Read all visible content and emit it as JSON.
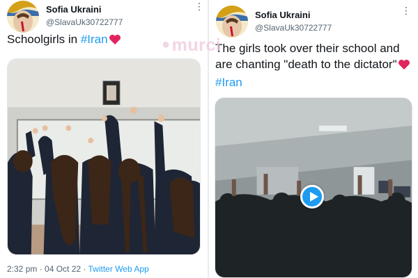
{
  "tweets": [
    {
      "author": {
        "name": "Sofia Ukraini",
        "handle": "@SlavaUk30722777"
      },
      "text": "Schoolgirls in ",
      "hashtag": "#Iran",
      "icons": {
        "menu": "more-vertical-icon",
        "emoji": "red-heart-icon"
      },
      "meta": {
        "time": "2:32 pm",
        "date": "04 Oct 22",
        "sep": " · ",
        "source": "Twitter Web App"
      }
    },
    {
      "author": {
        "name": "Sofia Ukraini",
        "handle": "@SlavaUk30722777"
      },
      "text": "The girls took over their school and are chanting \"death to the dictator\"",
      "hashtag": "#Iran",
      "icons": {
        "menu": "more-vertical-icon",
        "emoji": "red-heart-icon",
        "play": "play-icon"
      }
    }
  ],
  "watermark": "murci",
  "colors": {
    "link": "#1d9bf0",
    "heart": "#e0245e",
    "secondary": "#536471"
  }
}
